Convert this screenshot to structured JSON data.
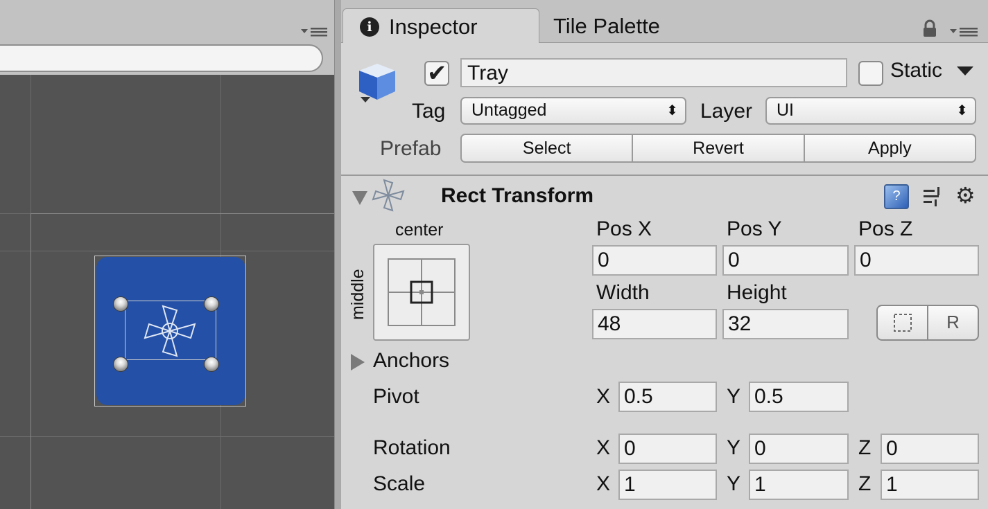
{
  "colors": {
    "scene_background": "#535353",
    "tray_blue": "#2451a7",
    "inspector_background": "#d6d6d6",
    "field_background": "#f0f0f0"
  },
  "scene": {
    "toolbar_menu_icon": "panel-menu-icon",
    "search_value": ""
  },
  "tabs": {
    "inspector": {
      "label": "Inspector",
      "icon": "info-icon"
    },
    "tile_palette": {
      "label": "Tile Palette"
    },
    "lock_icon": "lock-icon",
    "menu_icon": "panel-menu-icon"
  },
  "header": {
    "object_icon": "gameobject-cube-icon",
    "active": true,
    "name": "Tray",
    "static_checked": false,
    "static_label": "Static",
    "tag_label": "Tag",
    "tag_value": "Untagged",
    "layer_label": "Layer",
    "layer_value": "UI",
    "prefab_label": "Prefab",
    "prefab_buttons": {
      "select": "Select",
      "revert": "Revert",
      "apply": "Apply"
    }
  },
  "rect_transform": {
    "title": "Rect Transform",
    "anchor_horizontal": "center",
    "anchor_vertical": "middle",
    "pos_x_label": "Pos X",
    "pos_y_label": "Pos Y",
    "pos_z_label": "Pos Z",
    "pos_x": "0",
    "pos_y": "0",
    "pos_z": "0",
    "width_label": "Width",
    "height_label": "Height",
    "width": "48",
    "height": "32",
    "raw_edit_label": "R",
    "anchors_label": "Anchors",
    "pivot_label": "Pivot",
    "pivot": {
      "x_label": "X",
      "x": "0.5",
      "y_label": "Y",
      "y": "0.5"
    },
    "rotation_label": "Rotation",
    "rotation": {
      "x_label": "X",
      "x": "0",
      "y_label": "Y",
      "y": "0",
      "z_label": "Z",
      "z": "0"
    },
    "scale_label": "Scale",
    "scale": {
      "x_label": "X",
      "x": "1",
      "y_label": "Y",
      "y": "1",
      "z_label": "Z",
      "z": "1"
    }
  }
}
